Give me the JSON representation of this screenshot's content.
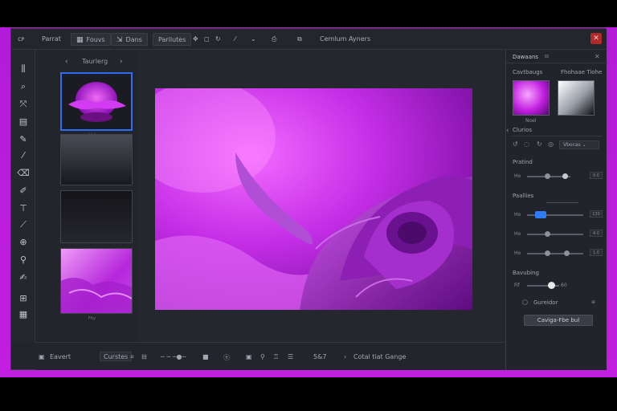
{
  "topbar": {
    "logo": "ᴄᴘ",
    "items": [
      "Parrat",
      "Fouvs",
      "Dans",
      "Parilutes"
    ],
    "center_label": "Cemlum",
    "center_label2": "Ayners",
    "close": "✕"
  },
  "thumbs": {
    "title": "Taurlerg",
    "caption1": "- - -",
    "caption4": "Fhy"
  },
  "bottombar": {
    "left_label": "Eavert",
    "pill1": "Curstes",
    "count": "5&7",
    "status": "Cotal tiat Gange"
  },
  "rightpanel": {
    "tab": "Dawaans",
    "sub1": "Cavtbaugs",
    "sub2": "Fhohaae Tiohe",
    "swatch_caption": "Noel",
    "section_colors": "Clurios",
    "colors_value": "Vbocas",
    "section_profile": "Pratind",
    "section_prochies": "Paallies",
    "section_brushing": "Bavubing",
    "row_labels": [
      "Ho",
      "Ho",
      "Ho",
      "Ho",
      "Fif"
    ],
    "checkbox_label": "Gureidor",
    "apply_button": "Caviga-Fbe",
    "apply_extra": "bul",
    "values": [
      "0.0",
      "130",
      "4.0",
      "1.0",
      "60"
    ]
  },
  "colors": {
    "accent": "#d84bf2",
    "magenta": "#c21fe0",
    "panel": "#23252c",
    "select_blue": "#2f6df0",
    "slider_blue": "#2f7af5"
  }
}
